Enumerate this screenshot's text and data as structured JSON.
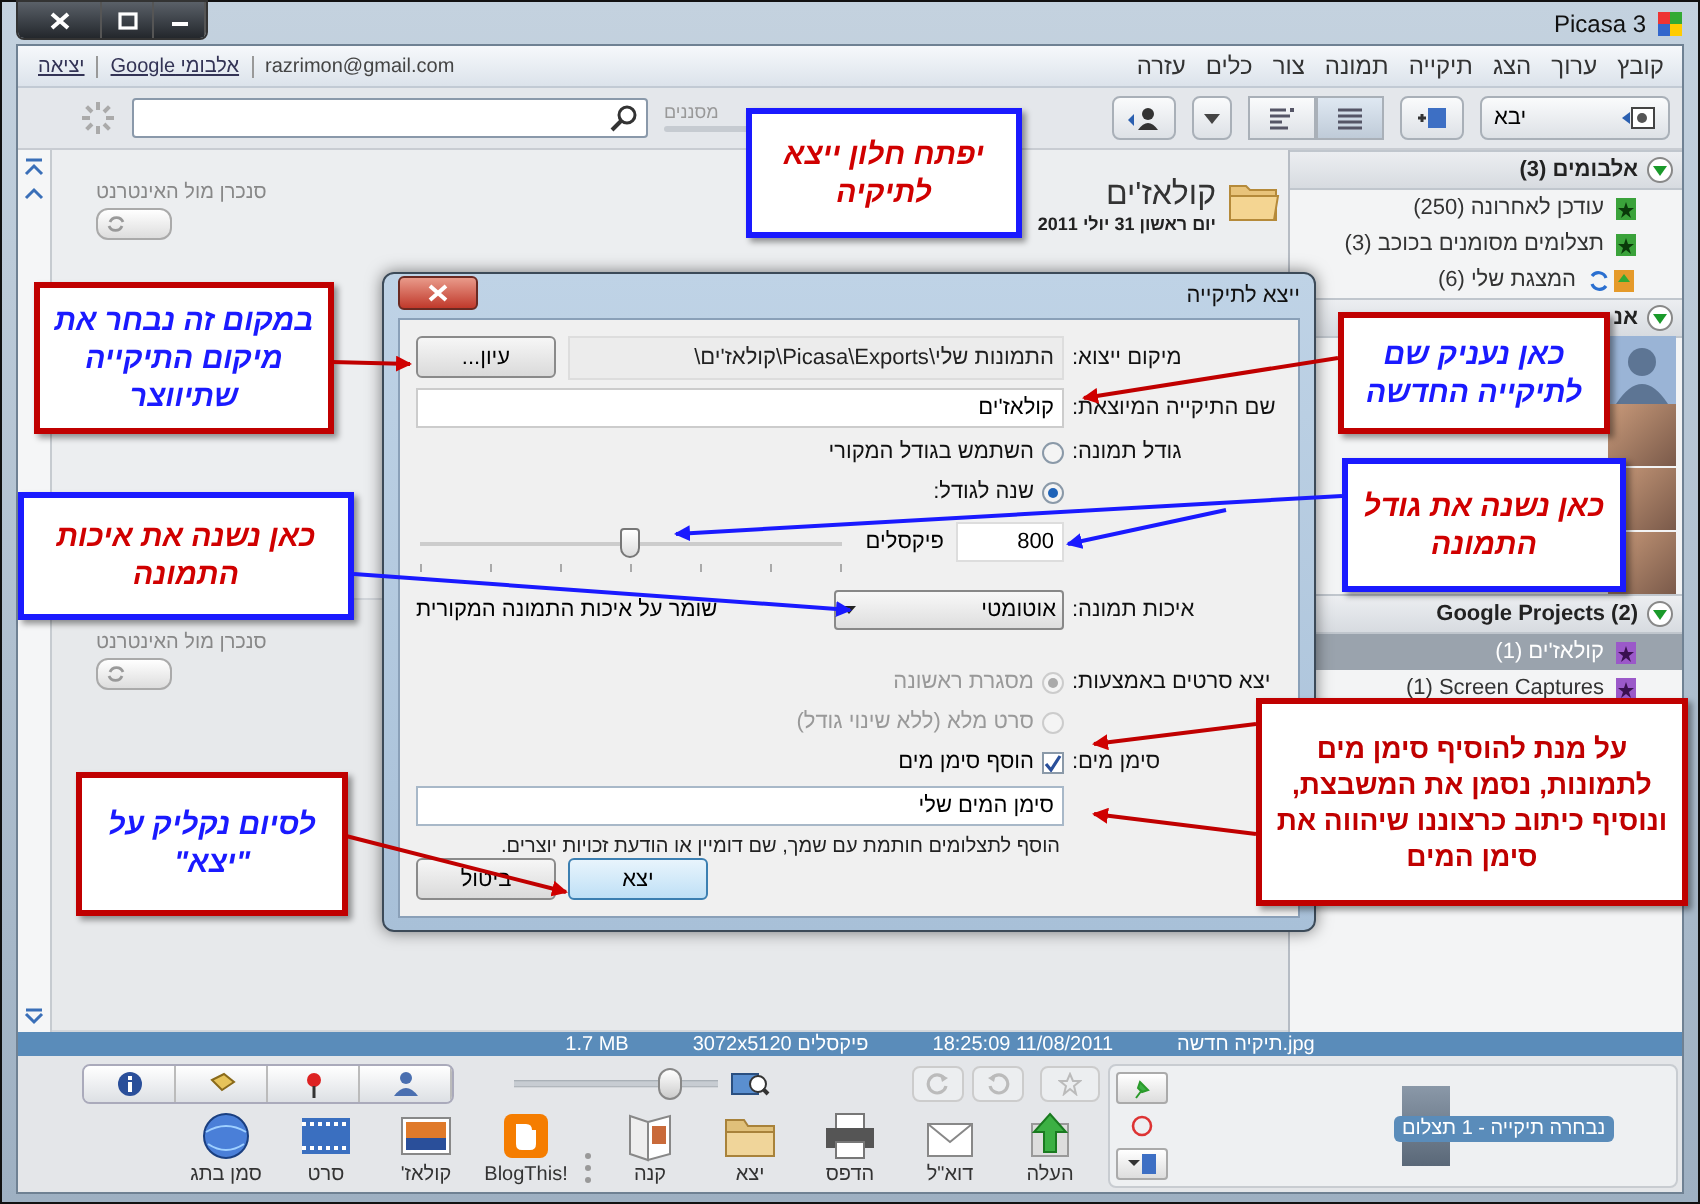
{
  "window": {
    "title": "Picasa 3"
  },
  "menu": [
    {
      "label": "קובץ"
    },
    {
      "label": "ערוך"
    },
    {
      "label": "הצג"
    },
    {
      "label": "תיקייה"
    },
    {
      "label": "תמונה"
    },
    {
      "label": "צור"
    },
    {
      "label": "כלים"
    },
    {
      "label": "עזרה"
    }
  ],
  "account": {
    "email": "razrimon@gmail.com",
    "links": [
      "אלבומי Google",
      "יציאה"
    ]
  },
  "toolbar": {
    "import_label": "יבא",
    "filter_label": "מסננים"
  },
  "sections": [
    {
      "sync_label": "סנכרן מול האינטרנט",
      "sync_on": false,
      "folder_title": "קולאז'ים",
      "folder_date": "יום ראשון 31 יולי 2011"
    },
    {
      "sync_label": "סנכרן מול האינטרנט",
      "sync_on": false
    }
  ],
  "sidebar": {
    "groups": [
      {
        "label": "אלבומים (3)",
        "expanded": true,
        "items": [
          {
            "kind": "album",
            "label": "עודכן לאחרונה (250)",
            "selected": false
          },
          {
            "kind": "album",
            "label": "תצלומים מסומנים בכוכב (3)",
            "selected": false
          },
          {
            "kind": "synced",
            "label": "המצגת שלי (6)",
            "selected": false
          }
        ]
      },
      {
        "label": "אנ",
        "expanded": true,
        "items": [
          {
            "kind": "avatar",
            "selected": false
          },
          {
            "kind": "photo",
            "selected": false
          },
          {
            "kind": "photo",
            "selected": false
          },
          {
            "kind": "photo",
            "selected": false
          }
        ]
      },
      {
        "label": "Google Projects (2)",
        "expanded": true,
        "items": [
          {
            "kind": "project",
            "label": "קולאז'ים (1)",
            "selected": true
          },
          {
            "kind": "project",
            "label": "(1) Screen Captures",
            "selected": false
          }
        ]
      }
    ]
  },
  "dialog": {
    "title": "ייצא לתיקייה",
    "export_location": {
      "label": "מיקום ייצוא:",
      "value": "התמונות שלי\\Picasa\\Exports\\קולאז'ים\\",
      "browse": "עיון..."
    },
    "folder_name": {
      "label": "שם התיקייה המיוצאת:",
      "value": "קולאז'ים"
    },
    "image_size": {
      "label": "גודל תמונה:",
      "options": [
        {
          "label": "השתמש בגודל המקורי",
          "selected": false
        },
        {
          "label": "שנה לגודל:",
          "selected": true
        }
      ],
      "level": 0.5,
      "pixels": "800",
      "unit": "פיקסלים"
    },
    "quality": {
      "label": "איכות תמונה:",
      "value": "אוטומטי",
      "note": "שומר על איכות התמונה המקורית"
    },
    "movies": {
      "label": "יצא סרטים באמצעות:",
      "disabled": true,
      "options": [
        {
          "label": "מסגרת ראשונה",
          "selected": true
        },
        {
          "label": "סרט מלא (ללא שינוי גודל)",
          "selected": false
        }
      ]
    },
    "watermark": {
      "label": "סימן מים:",
      "checked": true,
      "checkbox_label": "הוסף סימן מים",
      "value": "סימן המים שלי",
      "hint": "הוסף לתצלומים חותמת עם שמך, שם דומיין או הודעת זכויות יוצרים."
    },
    "buttons": [
      {
        "label": "יצא",
        "default": true
      },
      {
        "label": "ביטול",
        "default": false
      }
    ]
  },
  "status_bar": {
    "file": "תיקיה חדשה.jpg",
    "datetime": "18:25:09 11/08/2011",
    "dimensions": "3072x5120 פיקסלים",
    "size": "1.7 MB"
  },
  "bottom_bar": {
    "zoom": {
      "level": 0.8
    },
    "tools": [
      {
        "kind": "upload",
        "label": "העלה"
      },
      {
        "kind": "email",
        "label": "דוא\"ל"
      },
      {
        "kind": "print",
        "label": "הדפס"
      },
      {
        "kind": "export",
        "label": "יצא"
      },
      {
        "kind": "shop",
        "label": "קנה"
      },
      {
        "kind": "blog",
        "label": "BlogThis!"
      },
      {
        "kind": "collage",
        "label": "קולאז'"
      },
      {
        "kind": "movie",
        "label": "סרט"
      },
      {
        "kind": "geotag",
        "label": "סמן בתג"
      }
    ],
    "tray_label": "נבחרה תיקייה - 1 תצלום"
  },
  "callouts": [
    {
      "kind": "blue-frame",
      "text": "יפתח חלון ייצא לתיקיה"
    },
    {
      "kind": "red-frame",
      "text": "במקום זה נבחר את מיקום התיקייה שתיווצר"
    },
    {
      "kind": "blue-frame",
      "text": "כאן נשנה את איכות התמונה"
    },
    {
      "kind": "red-frame",
      "text": "לסיום נקליק על \"יצא\""
    },
    {
      "kind": "red-frame",
      "text": "כאן נעניק שם לתיקייה החדשה"
    },
    {
      "kind": "blue-frame",
      "text": "כאן נשנה את גודל התמונה"
    },
    {
      "kind": "red-solid",
      "text": "על מנת להוסיף סימן מים לתמונות, נסמן את המשבצת, ונוסיף כיתוב כרצוננו שיהווה את סימן המים"
    }
  ]
}
